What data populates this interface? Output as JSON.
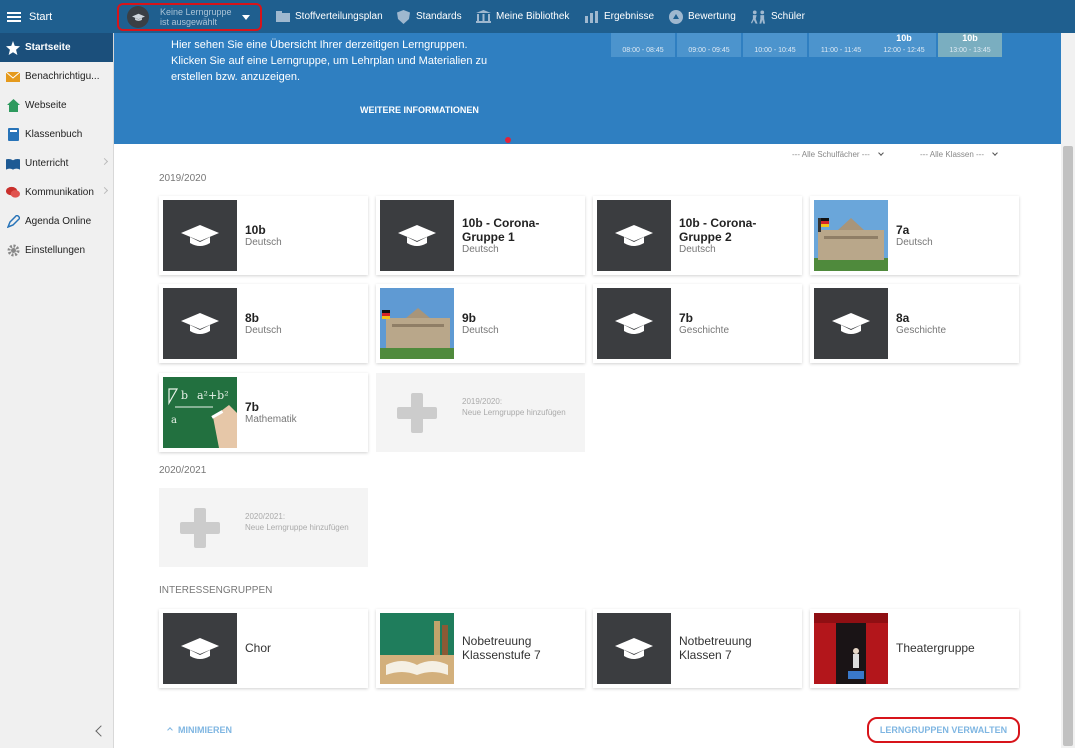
{
  "topnav": {
    "start_label": "Start",
    "learning_group_select": "Keine Lerngruppe ist ausgewählt",
    "items": [
      {
        "label": "Stoffverteilungsplan",
        "icon": "folder-icon"
      },
      {
        "label": "Standards",
        "icon": "shield-icon"
      },
      {
        "label": "Meine Bibliothek",
        "icon": "library-icon"
      },
      {
        "label": "Ergebnisse",
        "icon": "bar-chart-icon"
      },
      {
        "label": "Bewertung",
        "icon": "rating-icon"
      },
      {
        "label": "Schüler",
        "icon": "students-icon"
      }
    ]
  },
  "sidebar": {
    "items": [
      {
        "label": "Startseite",
        "active": true
      },
      {
        "label": "Benachrichtigu..."
      },
      {
        "label": "Webseite"
      },
      {
        "label": "Klassenbuch"
      },
      {
        "label": "Unterricht"
      },
      {
        "label": "Kommunikation"
      },
      {
        "label": "Agenda Online"
      },
      {
        "label": "Einstellungen"
      }
    ]
  },
  "banner": {
    "text": "Hier sehen Sie eine Übersicht Ihrer derzeitigen Lerngruppen. Klicken Sie auf eine Lerngruppe, um Lehrplan und Materialien zu erstellen bzw. anzuzeigen.",
    "more_label": "WEITERE INFORMATIONEN",
    "schedule": [
      {
        "class": "",
        "time": "08:00 - 08:45"
      },
      {
        "class": "",
        "time": "09:00 - 09:45"
      },
      {
        "class": "",
        "time": "10:00 - 10:45"
      },
      {
        "class": "",
        "time": "11:00 - 11:45"
      },
      {
        "class": "10b",
        "time": "12:00 - 12:45"
      },
      {
        "class": "10b",
        "time": "13:00 - 13:45"
      }
    ]
  },
  "filters": {
    "subjects": "--- Alle Schulfächer ---",
    "classes": "--- Alle Klassen ---"
  },
  "sections": {
    "s2019": "2019/2020",
    "s2020": "2020/2021",
    "interest": "INTERESSENGRUPPEN"
  },
  "groups2019": [
    {
      "name": "10b",
      "subject": "Deutsch"
    },
    {
      "name": "10b - Corona-Gruppe 1",
      "subject": "Deutsch"
    },
    {
      "name": "10b - Corona-Gruppe 2",
      "subject": "Deutsch"
    },
    {
      "name": "7a",
      "subject": "Deutsch"
    },
    {
      "name": "8b",
      "subject": "Deutsch"
    },
    {
      "name": "9b",
      "subject": "Deutsch"
    },
    {
      "name": "7b",
      "subject": "Geschichte"
    },
    {
      "name": "8a",
      "subject": "Geschichte"
    },
    {
      "name": "7b",
      "subject": "Mathematik"
    }
  ],
  "add2019": {
    "year": "2019/2020:",
    "label": "Neue Lerngruppe hinzufügen"
  },
  "add2020": {
    "year": "2020/2021:",
    "label": "Neue Lerngruppe hinzufügen"
  },
  "interest_groups": [
    {
      "name": "Chor"
    },
    {
      "name": "Nobetreuung Klassenstufe 7"
    },
    {
      "name": "Notbetreuung Klassen 7"
    },
    {
      "name": "Theatergruppe"
    }
  ],
  "footer": {
    "minimize": "MINIMIEREN",
    "manage": "LERNGRUPPEN VERWALTEN"
  },
  "colors": {
    "topnav": "#1f5f8f",
    "banner": "#2f7fc1",
    "sidebar_active": "#1b4f7b",
    "highlight": "#d7141a"
  }
}
